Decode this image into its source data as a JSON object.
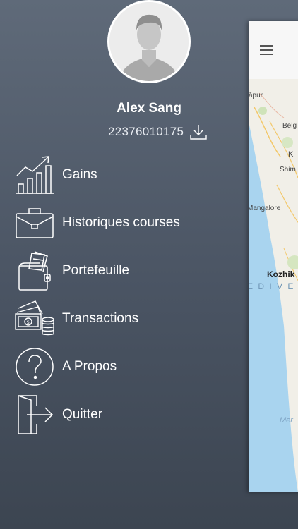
{
  "profile": {
    "name": "Alex Sang",
    "user_id": "22376010175"
  },
  "menu": [
    {
      "label": "Gains",
      "icon": "growth-chart-icon"
    },
    {
      "label": "Historiques courses",
      "icon": "briefcase-icon"
    },
    {
      "label": "Portefeuille",
      "icon": "wallet-icon"
    },
    {
      "label": "Transactions",
      "icon": "cash-coins-icon"
    },
    {
      "label": "A Propos",
      "icon": "question-circle-icon"
    },
    {
      "label": "Quitter",
      "icon": "exit-icon"
    }
  ],
  "map": {
    "labels": [
      "āpur",
      "Belg",
      "K A",
      "Shim",
      "Mangalore",
      "Kozhik",
      "E D I V E S",
      "Mer"
    ]
  },
  "colors": {
    "background_top": "#5f6a79",
    "background_bottom": "#3c4551",
    "sea": "#a9d4ef",
    "land": "#f1efe8"
  }
}
